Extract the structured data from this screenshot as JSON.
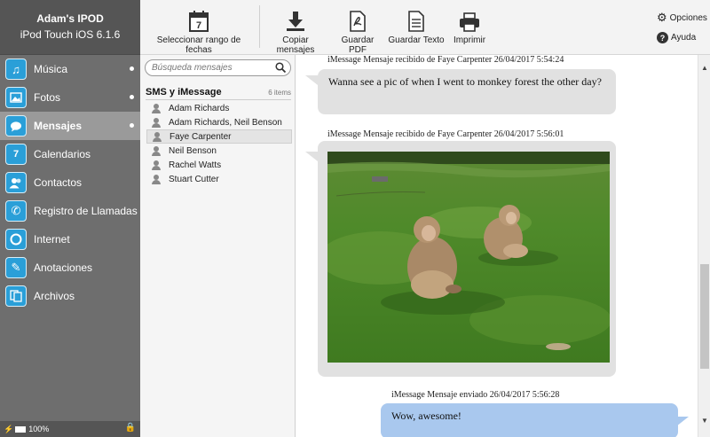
{
  "device": {
    "name": "Adam's IPOD",
    "model": "iPod Touch iOS 6.1.6"
  },
  "sidebar": {
    "items": [
      {
        "label": "Música",
        "icon": "music-icon",
        "dot": true
      },
      {
        "label": "Fotos",
        "icon": "photos-icon",
        "dot": true
      },
      {
        "label": "Mensajes",
        "icon": "messages-icon",
        "dot": true,
        "active": true
      },
      {
        "label": "Calendarios",
        "icon": "calendar-icon"
      },
      {
        "label": "Contactos",
        "icon": "contacts-icon"
      },
      {
        "label": "Registro de Llamadas",
        "icon": "phone-icon"
      },
      {
        "label": "Internet",
        "icon": "internet-icon"
      },
      {
        "label": "Anotaciones",
        "icon": "notes-icon"
      },
      {
        "label": "Archivos",
        "icon": "files-icon"
      }
    ]
  },
  "status": {
    "battery": "100%"
  },
  "toolbar": {
    "date_range_label": "Seleccionar rango de fechas",
    "calendar_day": "7",
    "copy_label": "Copiar mensajes",
    "pdf_label": "Guardar PDF",
    "text_label": "Guardar Texto",
    "print_label": "Imprimir",
    "options_label": "Opciones",
    "help_label": "Ayuda"
  },
  "threads": {
    "search_placeholder": "Búsqueda mensajes",
    "header": "SMS y iMessage",
    "count": "6 items",
    "items": [
      {
        "name": "Adam Richards"
      },
      {
        "name": "Adam Richards, Neil Benson"
      },
      {
        "name": "Faye Carpenter",
        "active": true
      },
      {
        "name": "Neil Benson"
      },
      {
        "name": "Rachel Watts"
      },
      {
        "name": "Stuart Cutter"
      }
    ]
  },
  "messages": [
    {
      "meta": "iMessage Mensaje recibido de Faye Carpenter 26/04/2017 5:54:24",
      "text": "Wanna see a pic of when I went to monkey forest the other day?"
    },
    {
      "meta": "iMessage Mensaje recibido de Faye Carpenter 26/04/2017 5:56:01"
    },
    {
      "meta": "iMessage Mensaje enviado 26/04/2017 5:56:28",
      "text": "Wow, awesome!"
    }
  ],
  "colors": {
    "accent": "#2a9fd8",
    "sent_bubble": "#a9c8ee",
    "received_bubble": "#e1e1e1",
    "sidebar": "#6e6e6e"
  }
}
